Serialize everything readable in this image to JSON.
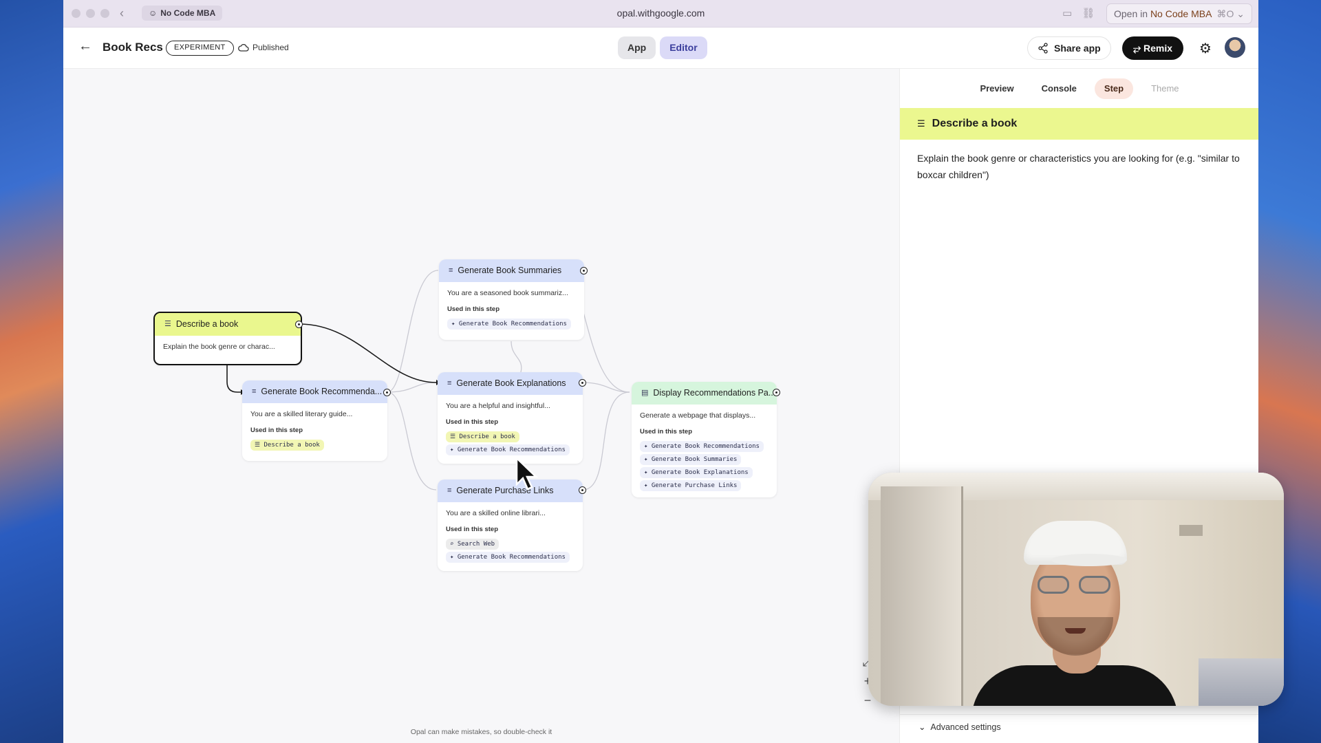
{
  "browser": {
    "site_chip": "No Code MBA",
    "url": "opal.withgoogle.com",
    "open_in_prefix": "Open in",
    "open_in_target": "No Code MBA",
    "open_in_shortcut": "⌘O"
  },
  "header": {
    "title": "Book Recs",
    "badge": "EXPERIMENT",
    "status": "Published",
    "view_toggle": [
      "App",
      "Editor"
    ],
    "active_view": "Editor",
    "share_label": "Share app",
    "remix_label": "Remix"
  },
  "canvas": {
    "disclaimer": "Opal can make mistakes, so double-check it",
    "used_label": "Used in this step",
    "nodes": {
      "describe": {
        "title": "Describe a book",
        "desc": "Explain the book genre or charac..."
      },
      "recommend": {
        "title": "Generate Book Recommenda...",
        "desc": "You are a skilled literary guide...",
        "chips": [
          "Describe a book"
        ]
      },
      "summaries": {
        "title": "Generate Book Summaries",
        "desc": "You are a seasoned book summariz...",
        "chips": [
          "Generate Book Recommendations"
        ]
      },
      "explanations": {
        "title": "Generate Book Explanations",
        "desc": "You are a helpful and insightful...",
        "chips": [
          "Describe a book",
          "Generate Book Recommendations"
        ]
      },
      "purchase": {
        "title": "Generate Purchase Links",
        "desc": "You are a skilled online librari...",
        "chips": [
          "Search Web",
          "Generate Book Recommendations"
        ]
      },
      "display": {
        "title": "Display Recommendations Pa...",
        "desc": "Generate a webpage that displays...",
        "chips": [
          "Generate Book Recommendations",
          "Generate Book Summaries",
          "Generate Book Explanations",
          "Generate Purchase Links"
        ]
      }
    }
  },
  "panel": {
    "tabs": [
      "Preview",
      "Console",
      "Step",
      "Theme"
    ],
    "active_tab": "Step",
    "step_title": "Describe a book",
    "step_text": "Explain the book genre or characteristics you are looking for (e.g. \"similar to boxcar children\")",
    "advanced": "Advanced settings"
  },
  "icons": {
    "input_node": "input-icon",
    "generate_node": "generate-icon",
    "output_node": "display-icon",
    "chip_step": "sparkle-icon",
    "chip_search": "search-icon"
  },
  "colors": {
    "input_header": "#eaf78e",
    "generate_header": "#d7e0fa",
    "output_header": "#d6f5dd",
    "editor_active": "#dbdaf7",
    "step_tab_active": "#fbe6df"
  }
}
